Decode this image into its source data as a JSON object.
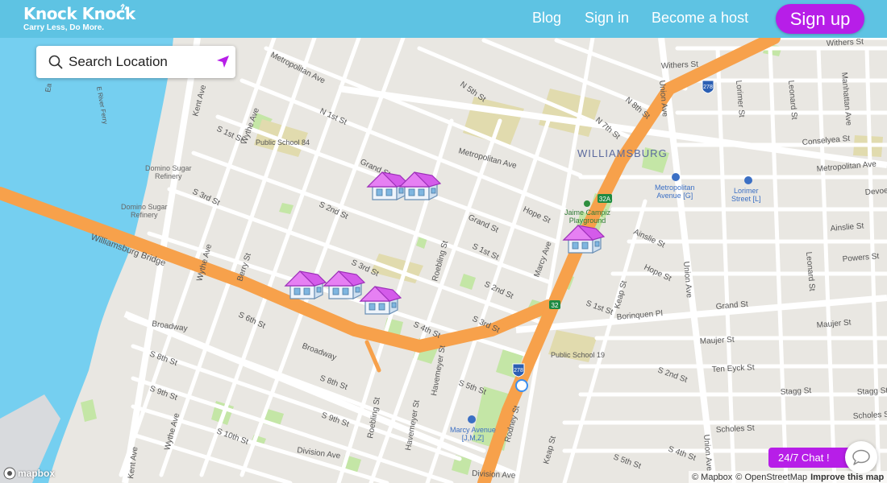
{
  "header": {
    "brand_name": "Knock Knock",
    "brand_tagline": "Carry Less, Do More.",
    "nav": {
      "blog": "Blog",
      "sign_in": "Sign in",
      "become_host": "Become a host"
    },
    "sign_up": "Sign up"
  },
  "search": {
    "placeholder": "Search Location",
    "value": ""
  },
  "chat": {
    "label": "24/7 Chat !"
  },
  "attribution": {
    "mapbox": "© Mapbox",
    "osm": "© OpenStreetMap",
    "improve": "Improve this map"
  },
  "mapbox_logo": "mapbox",
  "map": {
    "neighborhood": "WILLIAMSBURG",
    "pois": {
      "public_school_84": "Public School 84",
      "domino_1": "Domino Sugar\nRefinery",
      "domino_2": "Domino Sugar\nRefinery",
      "jaime_campiz": "Jaime Campiz\nPlayground",
      "public_school_19": "Public School 19",
      "metropolitan_avenue_g": "Metropolitan\nAvenue [G]",
      "lorimer_street_l": "Lorimer\nStreet [L]",
      "marcy_avenue_jmz": "Marcy Avenue\n[J,M,Z]"
    },
    "streets": {
      "metropolitan_ave_1": "Metropolitan Ave",
      "metropolitan_ave_2": "Metropolitan Ave",
      "metropolitan_ave_3": "Metropolitan Ave",
      "n5th": "N 5th St",
      "n1st": "N 1st St",
      "n8th": "N 8th St",
      "n7th": "N 7th St",
      "withers_1": "Withers St",
      "withers_2": "Withers St",
      "kent_ave_1": "Kent Ave",
      "kent_ave_2": "Kent Ave",
      "wythe_ave_1": "Wythe Ave",
      "wythe_ave_2": "Wythe Ave",
      "wythe_ave_3": "Wythe Ave",
      "s1st": "S 1st St",
      "s2nd": "S 2nd St",
      "s3rd": "S 3rd St",
      "s1st_b": "S 1st St",
      "s2nd_b": "S 2nd St",
      "s3rd_b": "S 3rd St",
      "s3rd_c": "S 3rd St",
      "s4th": "S 4th St",
      "s5th": "S 5th St",
      "s6th": "S 6th St",
      "s8th": "S 8th St",
      "s8th_b": "S 8th St",
      "s9th": "S 9th St",
      "s9th_b": "S 9th St",
      "s10th": "S 10th St",
      "s1st_c": "S 1st St",
      "s2nd_c": "S 2nd St",
      "s4th_b": "S 4th St",
      "s5th_b": "S 5th St",
      "grand_st_1": "Grand St",
      "grand_st_2": "Grand St",
      "grand_st_3": "Grand St",
      "hope_st_1": "Hope St",
      "hope_st_2": "Hope St",
      "ainslie": "Ainslie St",
      "ainslie_b": "Ainslie St",
      "powers": "Powers St",
      "devoe": "Devoe St",
      "conselyea": "Conselyea St",
      "maujer_1": "Maujer St",
      "maujer_2": "Maujer St",
      "ten_eyck": "Ten Eyck St",
      "stagg_1": "Stagg St",
      "stagg_2": "Stagg St",
      "scholes_1": "Scholes St",
      "scholes_2": "Scholes St",
      "union_ave_1": "Union Ave",
      "union_ave_2": "Union Ave",
      "union_ave_3": "Union Ave",
      "lorimer_st_1": "Lorimer St",
      "leonard_st": "Leonard St",
      "leonard_st_2": "Leonard St",
      "manhattan_ave": "Manhattan Ave",
      "marcy_ave": "Marcy Ave",
      "roebling_1": "Roebling St",
      "roebling_2": "Roebling St",
      "havemeyer_1": "Havemeyer St",
      "havemeyer_2": "Havemeyer St",
      "rodney": "Rodney St",
      "keap_1": "Keap St",
      "keap_2": "Keap St",
      "berry": "Berry St",
      "broadway_1": "Broadway",
      "broadway_2": "Broadway",
      "division": "Division Ave",
      "division_2": "Division Ave",
      "boriquen": "Borinquen Pl",
      "williamsburg_bridge": "Williamsburg Bridge",
      "e_river_ferry": "E River Ferry",
      "e_label": "Ea"
    },
    "shields": {
      "i278_top": "278",
      "i278_bottom": "278",
      "exit_32a": "32A",
      "exit_32": "32"
    }
  },
  "colors": {
    "topbar": "#5ec3e3",
    "brand_purple": "#b71ee8",
    "water": "#75cff0",
    "land": "#e9e7e2",
    "highway": "#f7a14b",
    "park": "#c4e6a6",
    "school": "#e1dbae"
  },
  "listings": [
    {
      "name": "house-1"
    },
    {
      "name": "house-2"
    },
    {
      "name": "house-3"
    },
    {
      "name": "house-4"
    },
    {
      "name": "house-5"
    },
    {
      "name": "house-6"
    }
  ]
}
